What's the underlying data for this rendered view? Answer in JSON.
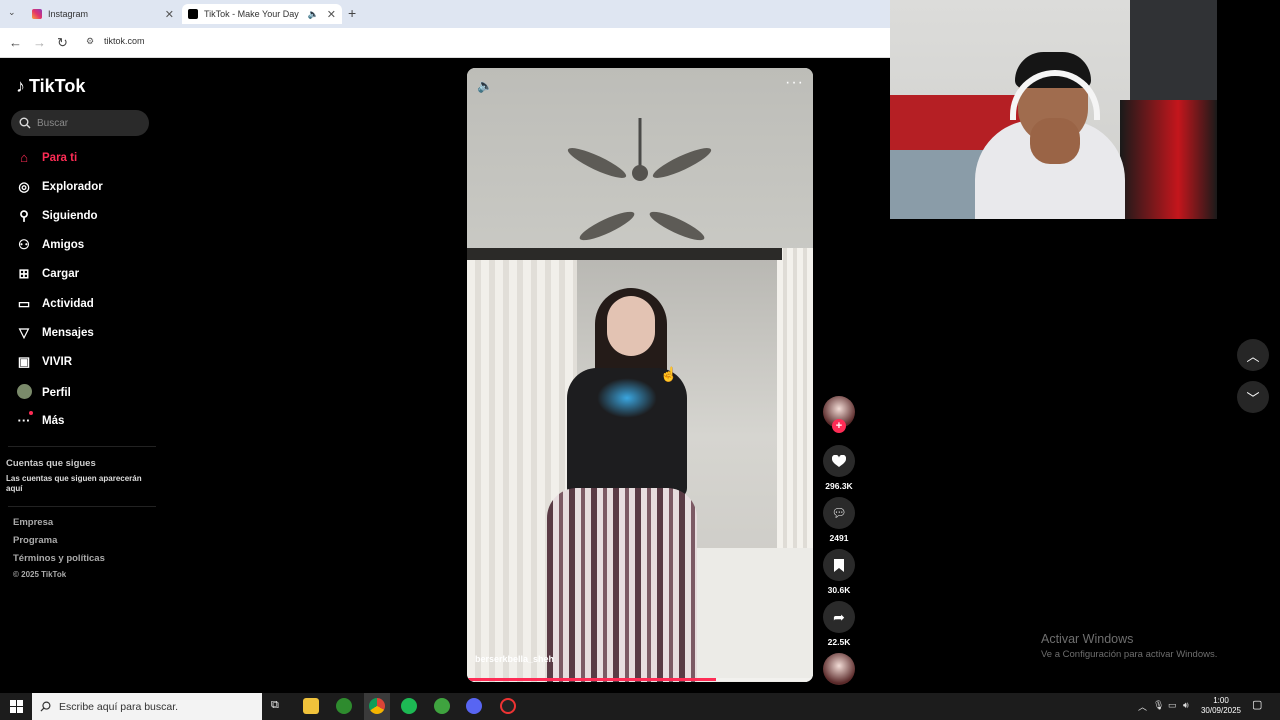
{
  "browser": {
    "tabs": [
      {
        "title": "Instagram",
        "close": "✕"
      },
      {
        "title": "TikTok - Make Your Day",
        "close": "✕"
      }
    ],
    "new_tab": "+",
    "url": "tiktok.com"
  },
  "sidebar": {
    "brand": "TikTok",
    "search_placeholder": "Buscar",
    "items": [
      {
        "label": "Para ti",
        "icon": "home-icon",
        "active": true
      },
      {
        "label": "Explorador",
        "icon": "compass-icon"
      },
      {
        "label": "Siguiendo",
        "icon": "following-icon"
      },
      {
        "label": "Amigos",
        "icon": "friends-icon"
      },
      {
        "label": "Cargar",
        "icon": "upload-icon"
      },
      {
        "label": "Actividad",
        "icon": "activity-icon"
      },
      {
        "label": "Mensajes",
        "icon": "messages-icon"
      },
      {
        "label": "VIVIR",
        "icon": "live-icon"
      },
      {
        "label": "Perfil",
        "icon": "profile-avatar"
      },
      {
        "label": "Más",
        "icon": "more-icon"
      }
    ],
    "following_title": "Cuentas que sigues",
    "following_desc": "Las cuentas que siguen aparecerán aquí",
    "footer": [
      "Empresa",
      "Programa",
      "Términos y políticas"
    ],
    "copyright": "© 2025 TikTok"
  },
  "video": {
    "username": "berserkbella_sheh",
    "progress": 0.72
  },
  "actions": {
    "likes": "296.3K",
    "comments": "2491",
    "saves": "30.6K",
    "shares": "22.5K"
  },
  "watermark": {
    "title": "Activar Windows",
    "subtitle": "Ve a Configuración para activar Windows."
  },
  "taskbar": {
    "search_placeholder": "Escribe aquí para buscar.",
    "time": "1:00",
    "date": "30/09/2025"
  },
  "colors": {
    "accent": "#fe2c55",
    "sidebar_bg": "#000000",
    "taskbar_bg": "#1c1c1c"
  }
}
